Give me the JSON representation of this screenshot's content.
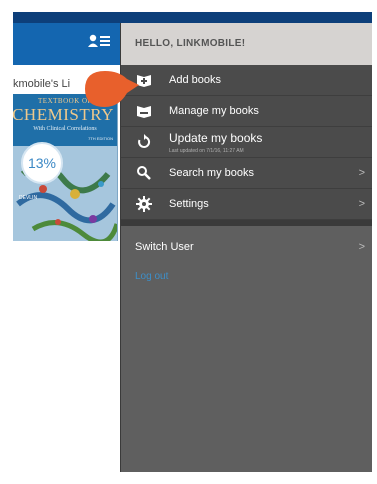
{
  "library": {
    "title": "kmobile's Li",
    "book": {
      "line1": "TEXTBOOK OF",
      "line2": "CHEMISTRY",
      "line3": "With Clinical Correlations",
      "edition": "7TH EDITION",
      "author": "DEVLIN",
      "progress": "13%"
    }
  },
  "drawer": {
    "greeting": "HELLO, LINKMOBILE!",
    "items": [
      {
        "label": "Add books",
        "icon": "add-book-icon"
      },
      {
        "label": "Manage my books",
        "icon": "manage-books-icon"
      },
      {
        "label": "Update my books",
        "sub": "Last updated on 7/1/16, 11:27 AM",
        "icon": "refresh-icon"
      },
      {
        "label": "Search my books",
        "icon": "search-icon",
        "chevron": ">"
      },
      {
        "label": "Settings",
        "icon": "gear-icon",
        "chevron": ">"
      }
    ],
    "switch_user": "Switch User",
    "switch_chevron": ">",
    "logout": "Log out"
  },
  "colors": {
    "header_blue": "#1466b0",
    "drawer_gray": "#4b4b4b",
    "pointer_orange": "#e8602c",
    "logout_link": "#3d8fc9"
  }
}
